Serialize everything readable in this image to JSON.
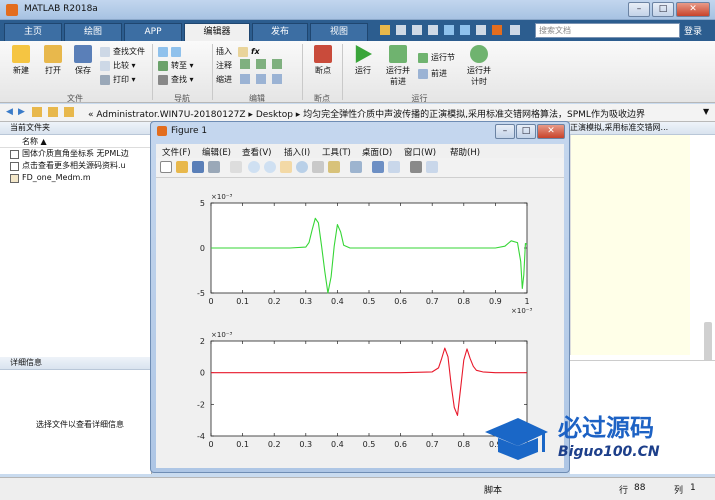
{
  "window": {
    "title": "MATLAB R2018a"
  },
  "tabs": [
    {
      "label": "主页",
      "active": false
    },
    {
      "label": "绘图",
      "active": false
    },
    {
      "label": "APP",
      "active": false
    },
    {
      "label": "编辑器",
      "active": true
    },
    {
      "label": "发布",
      "active": false
    },
    {
      "label": "视图",
      "active": false
    }
  ],
  "search": {
    "placeholder": "搜索文档"
  },
  "login_label": "登录",
  "ribbon": {
    "groups": [
      "文件",
      "导航",
      "编辑",
      "断点",
      "运行"
    ],
    "file": {
      "new": "新建",
      "open": "打开",
      "save": "保存",
      "find_files": "查找文件",
      "compare": "比较",
      "print": "打印"
    },
    "nav": {
      "goto": "转至",
      "find": "查找"
    },
    "edit": {
      "insert": "插入",
      "comment": "注释",
      "indent": "缩进",
      "fx": "fx"
    },
    "breakpoint": {
      "breakpoints": "断点"
    },
    "run": {
      "run": "运行",
      "run_advance": "运行并前进",
      "run_section": "运行节",
      "advance": "前进",
      "run_time": "运行并计时"
    }
  },
  "address": {
    "path": "« Administrator.WIN7U-20180127Z ▸ Desktop ▸ 均匀完全弹性介质中声波传播的正演模拟,采用标准交错网格算法，SPML作为吸收边界"
  },
  "current_folder": {
    "header": "当前文件夹",
    "column": "名称 ▲",
    "files": [
      "国体介质直角坐标系 无PML边",
      "点击查看更多相关源码资料.u",
      "FD_one_Medm.m"
    ]
  },
  "details": {
    "header": "详细信息",
    "empty_text": "选择文件以查看详细信息"
  },
  "right_panel": {
    "title_fragment": "正演模拟,采用标准交错网..."
  },
  "figure": {
    "title": "Figure 1",
    "menu": [
      "文件(F)",
      "编辑(E)",
      "查看(V)",
      "插入(I)",
      "工具(T)",
      "桌面(D)",
      "窗口(W)",
      "帮助(H)"
    ]
  },
  "status": {
    "label": "脚本",
    "row_label": "行",
    "row": "88",
    "col_label": "列",
    "col": "1"
  },
  "watermark": {
    "title": "必过源码",
    "site": "Biguo100.CN"
  },
  "colors": {
    "plot_top": "#36d636",
    "plot_bottom": "#e8192b",
    "tab_bar": "#2c5d8f"
  },
  "chart_data": [
    {
      "type": "line",
      "x_ticks": [
        "0",
        "0.1",
        "0.2",
        "0.3",
        "0.4",
        "0.5",
        "0.6",
        "0.7",
        "0.8",
        "0.9",
        "1"
      ],
      "y_ticks": [
        "5",
        "0",
        "-5"
      ],
      "x_exponent": "×10⁻³",
      "y_exponent": "×10⁻³",
      "xlim": [
        0,
        1
      ],
      "ylim": [
        -5,
        5
      ],
      "series": [
        {
          "color": "#36d636",
          "x": [
            0,
            0.25,
            0.3,
            0.31,
            0.32,
            0.33,
            0.34,
            0.35,
            0.36,
            0.37,
            0.38,
            0.39,
            0.4,
            0.41,
            0.42,
            0.44,
            0.6,
            0.9,
            0.93,
            0.95,
            0.97,
            0.98,
            0.985,
            0.99,
            0.995,
            1.0
          ],
          "y": [
            0,
            0,
            0.1,
            0.6,
            2.0,
            3.3,
            2.8,
            0.2,
            -2.6,
            -5.0,
            -3.2,
            0.2,
            2.6,
            1.8,
            0.3,
            0,
            0,
            0,
            0.2,
            0.8,
            0.6,
            -1.5,
            -4.5,
            -3.0,
            0.5,
            0.4
          ]
        }
      ]
    },
    {
      "type": "line",
      "x_ticks": [
        "0",
        "0.1",
        "0.2",
        "0.3",
        "0.4",
        "0.5",
        "0.6",
        "0.7",
        "0.8",
        "0.9",
        "1"
      ],
      "y_ticks": [
        "2",
        "0",
        "-2",
        "-4"
      ],
      "x_exponent": "×10⁻³",
      "y_exponent": "×10⁻³",
      "xlim": [
        0,
        1
      ],
      "ylim": [
        -4,
        2
      ],
      "series": [
        {
          "color": "#e8192b",
          "x": [
            0,
            0.6,
            0.7,
            0.72,
            0.73,
            0.74,
            0.75,
            0.76,
            0.77,
            0.78,
            0.79,
            0.8,
            0.81,
            0.82,
            0.83,
            0.84,
            0.86,
            0.9,
            1.0
          ],
          "y": [
            0,
            0,
            0.05,
            0.3,
            0.9,
            1.55,
            1.0,
            -0.8,
            -2.2,
            -2.7,
            -1.0,
            0.8,
            1.5,
            0.9,
            0.4,
            0.15,
            0.05,
            0,
            0
          ]
        }
      ]
    }
  ]
}
